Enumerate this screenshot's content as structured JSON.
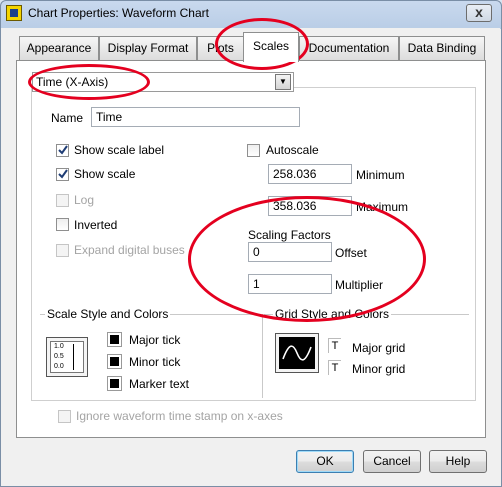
{
  "window": {
    "title": "Chart Properties: Waveform Chart",
    "close_glyph": "x"
  },
  "tabs": [
    {
      "label": "Appearance"
    },
    {
      "label": "Display Format"
    },
    {
      "label": "Plots"
    },
    {
      "label": "Scales",
      "active": true
    },
    {
      "label": "Documentation"
    },
    {
      "label": "Data Binding"
    }
  ],
  "scale_select": {
    "value": "Time (X-Axis)"
  },
  "name": {
    "label": "Name",
    "value": "Time"
  },
  "options": {
    "show_scale_label": {
      "label": "Show scale label",
      "checked": true
    },
    "show_scale": {
      "label": "Show scale",
      "checked": true
    },
    "log": {
      "label": "Log",
      "checked": false,
      "disabled": true
    },
    "inverted": {
      "label": "Inverted",
      "checked": false
    },
    "expand_digital_buses": {
      "label": "Expand digital buses",
      "checked": false,
      "disabled": true
    },
    "autoscale": {
      "label": "Autoscale",
      "checked": false
    }
  },
  "range": {
    "minimum_value": "258.036",
    "minimum_label": "Minimum",
    "maximum_value": "358.036",
    "maximum_label": "Maximum"
  },
  "scaling_factors": {
    "title": "Scaling Factors",
    "offset_value": "0",
    "offset_label": "Offset",
    "multiplier_value": "1",
    "multiplier_label": "Multiplier"
  },
  "scale_style": {
    "title": "Scale Style and Colors",
    "icon_ticks": [
      "1.0",
      "0.5",
      "0.0"
    ],
    "major_tick": "Major tick",
    "minor_tick": "Minor tick",
    "marker_text": "Marker text"
  },
  "grid_style": {
    "title": "Grid Style and Colors",
    "major_grid": "Major grid",
    "minor_grid": "Minor grid"
  },
  "ignore_timestamp": {
    "label": "Ignore waveform time stamp on x-axes",
    "checked": false,
    "disabled": true
  },
  "buttons": {
    "ok": "OK",
    "cancel": "Cancel",
    "help": "Help"
  },
  "colors": {
    "annotation": "#e4001f",
    "title_gradient": "#c9d9ee",
    "panel": "#f0f0f0"
  }
}
